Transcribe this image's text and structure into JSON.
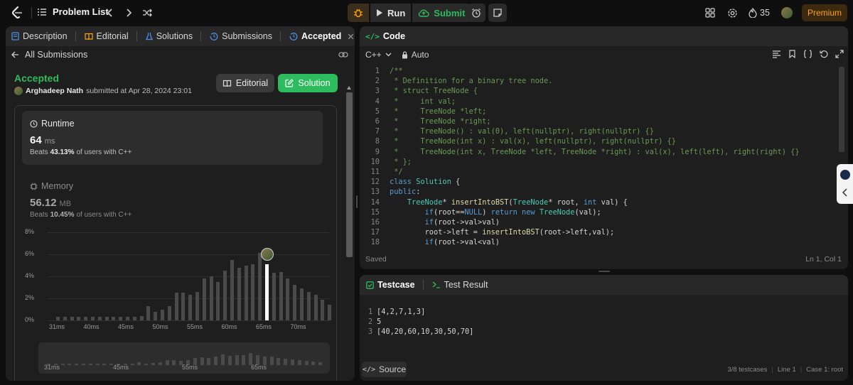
{
  "topbar": {
    "problem_list": "Problem List",
    "run": "Run",
    "submit": "Submit",
    "streak": "35",
    "premium": "Premium"
  },
  "left_tabs": [
    "Description",
    "Editorial",
    "Solutions",
    "Submissions",
    "Accepted"
  ],
  "all_submissions": "All Submissions",
  "result": {
    "status": "Accepted",
    "user": "Arghadeep Nath",
    "submitted": "submitted at Apr 28, 2024 23:01",
    "editorial_btn": "Editorial",
    "solution_btn": "Solution"
  },
  "runtime": {
    "title": "Runtime",
    "value": "64",
    "unit": "ms",
    "beats_prefix": "Beats",
    "beats_pct": "43.13%",
    "beats_suffix": "of users with C++"
  },
  "memory": {
    "title": "Memory",
    "value": "56.12",
    "unit": "MB",
    "beats_prefix": "Beats",
    "beats_pct": "10.45%",
    "beats_suffix": "of users with C++"
  },
  "chart_data": {
    "type": "bar",
    "y_ticks": [
      "8%",
      "6%",
      "4%",
      "2%",
      "0%"
    ],
    "x_ticks": [
      "31ms",
      "40ms",
      "45ms",
      "50ms",
      "55ms",
      "60ms",
      "65ms",
      "70ms"
    ],
    "ylim": [
      0,
      8
    ],
    "values": [
      0.3,
      0.3,
      0.3,
      0.3,
      0.3,
      0.3,
      0.3,
      0.3,
      0.3,
      0.3,
      0.3,
      0.3,
      0.4,
      1.3,
      0.8,
      1,
      1.3,
      2.5,
      2.5,
      2.3,
      2.6,
      3.8,
      4,
      3.5,
      4.5,
      5.5,
      4.8,
      5,
      5.1,
      6.1,
      5.1,
      4.3,
      4.4,
      3.8,
      3.2,
      2.9,
      2.6,
      2.3,
      1.9,
      1.4
    ],
    "highlight_index": 30,
    "mini_x_ticks": [
      "31ms",
      "45ms",
      "55ms",
      "65ms"
    ]
  },
  "code": {
    "header": "Code",
    "lang": "C++",
    "auto": "Auto",
    "saved": "Saved",
    "cursor": "Ln 1, Col 1"
  },
  "code_lines": [
    [
      [
        "cmt",
        "/**"
      ]
    ],
    [
      [
        "cmt",
        " * Definition for a binary tree node."
      ]
    ],
    [
      [
        "cmt",
        " * struct TreeNode {"
      ]
    ],
    [
      [
        "cmt",
        " *     int val;"
      ]
    ],
    [
      [
        "cmt",
        " *     TreeNode *left;"
      ]
    ],
    [
      [
        "cmt",
        " *     TreeNode *right;"
      ]
    ],
    [
      [
        "cmt",
        " *     TreeNode() : val(0), left(nullptr), right(nullptr) {}"
      ]
    ],
    [
      [
        "cmt",
        " *     TreeNode(int x) : val(x), left(nullptr), right(nullptr) {}"
      ]
    ],
    [
      [
        "cmt",
        " *     TreeNode(int x, TreeNode *left, TreeNode *right) : val(x), left(left), right(right) {}"
      ]
    ],
    [
      [
        "cmt",
        " * };"
      ]
    ],
    [
      [
        "cmt",
        " */"
      ]
    ],
    [
      [
        "kw",
        "class "
      ],
      [
        "ty",
        "Solution"
      ],
      [
        "txt",
        " {"
      ]
    ],
    [
      [
        "kw",
        "public"
      ],
      [
        "txt",
        ":"
      ]
    ],
    [
      [
        "txt",
        "    "
      ],
      [
        "ty",
        "TreeNode"
      ],
      [
        "txt",
        "* "
      ],
      [
        "fn",
        "insertIntoBST"
      ],
      [
        "txt",
        "("
      ],
      [
        "ty",
        "TreeNode"
      ],
      [
        "txt",
        "* root, "
      ],
      [
        "kw",
        "int"
      ],
      [
        "txt",
        " val) {"
      ]
    ],
    [
      [
        "txt",
        "        "
      ],
      [
        "kw",
        "if"
      ],
      [
        "txt",
        "(root=="
      ],
      [
        "kw",
        "NULL"
      ],
      [
        "txt",
        ") "
      ],
      [
        "kw",
        "return new "
      ],
      [
        "ty",
        "TreeNode"
      ],
      [
        "txt",
        "(val);"
      ]
    ],
    [
      [
        "txt",
        "        "
      ],
      [
        "kw",
        "if"
      ],
      [
        "txt",
        "(root->val>val)"
      ]
    ],
    [
      [
        "txt",
        "        root->left = "
      ],
      [
        "fn",
        "insertIntoBST"
      ],
      [
        "txt",
        "(root->left,val);"
      ]
    ],
    [
      [
        "txt",
        "        "
      ],
      [
        "kw",
        "if"
      ],
      [
        "txt",
        "(root->val<val)"
      ]
    ]
  ],
  "testcase": {
    "tab1": "Testcase",
    "tab2": "Test Result",
    "lines": [
      "[4,2,7,1,3]",
      "5",
      "[40,20,60,10,30,50,70]"
    ],
    "source": "Source",
    "count": "3/8 testcases",
    "line": "Line 1",
    "case": "Case 1: root"
  }
}
